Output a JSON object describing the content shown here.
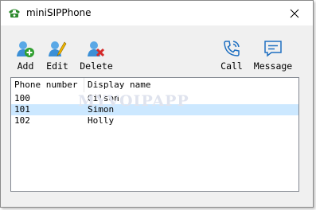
{
  "window": {
    "title": "miniSIPPhone"
  },
  "toolbar": {
    "add_label": "Add",
    "edit_label": "Edit",
    "delete_label": "Delete",
    "call_label": "Call",
    "message_label": "Message"
  },
  "list": {
    "columns": [
      "Phone number",
      "Display name"
    ],
    "rows": [
      {
        "number": "100",
        "name": "Gilson",
        "selected": false
      },
      {
        "number": "101",
        "name": "Simon",
        "selected": true
      },
      {
        "number": "102",
        "name": "Holly",
        "selected": false
      }
    ]
  },
  "watermark": "MYVOIPAPP",
  "colors": {
    "selection": "#cce8ff",
    "accent_blue": "#1e6fc1",
    "add_green": "#2e9e2e",
    "delete_red": "#d42a2a"
  }
}
